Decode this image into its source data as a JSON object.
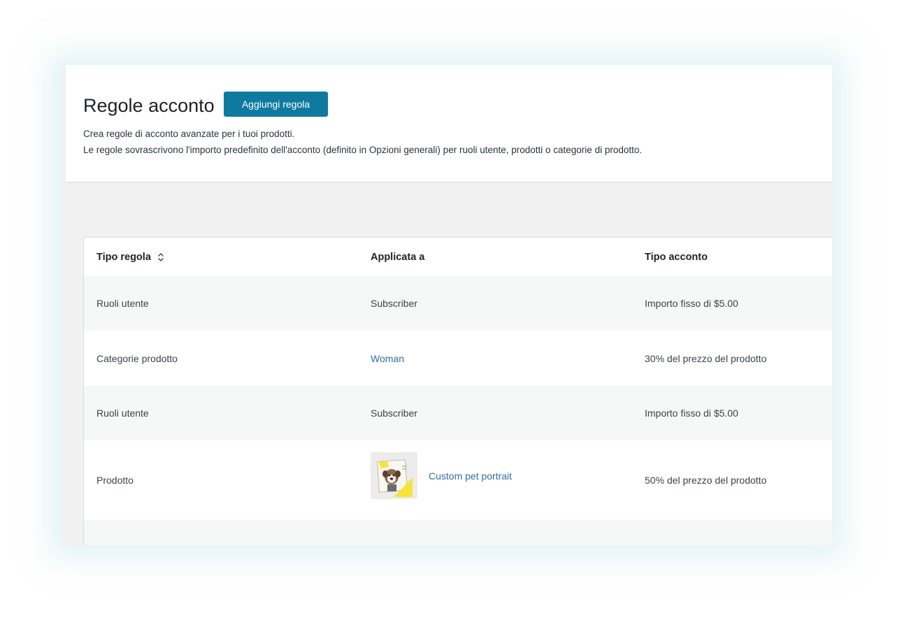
{
  "header": {
    "title": "Regole acconto",
    "add_button_label": "Aggiungi regola",
    "description_line1": "Crea regole di acconto avanzate per i tuoi prodotti.",
    "description_line2": "Le regole sovrascrivono l'importo predefinito dell'acconto (definito in Opzioni generali) per ruoli utente, prodotti o categorie di prodotto."
  },
  "table": {
    "columns": [
      "Tipo regola",
      "Applicata a",
      "Tipo acconto"
    ],
    "sort_icon": "sort-updown-icon",
    "rows": [
      {
        "type": "Ruoli utente",
        "applied_to": "Subscriber",
        "deposit": "Importo fisso di $5.00"
      },
      {
        "type": "Categorie prodotto",
        "applied_to": "Woman",
        "deposit": "30% del prezzo del prodotto"
      },
      {
        "type": "Ruoli utente",
        "applied_to": "Subscriber",
        "deposit": "Importo fisso di $5.00"
      },
      {
        "type": "Prodotto",
        "applied_to": "Custom pet portrait",
        "deposit": "50% del prezzo del prodotto"
      }
    ]
  },
  "colors": {
    "button_bg": "#0f7aa0",
    "link": "#2f6f9f",
    "row_stripe": "#f6f7f7"
  }
}
